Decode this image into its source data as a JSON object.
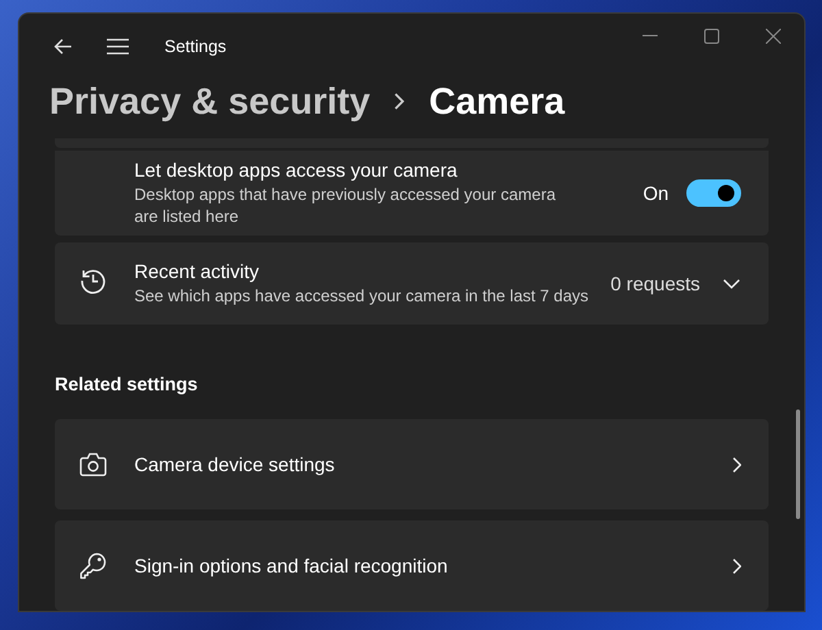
{
  "window": {
    "title": "Settings"
  },
  "breadcrumb": {
    "parent": "Privacy & security",
    "current": "Camera"
  },
  "desktop_apps": {
    "title": "Let desktop apps access your camera",
    "description": "Desktop apps that have previously accessed your camera are listed here",
    "state_label": "On",
    "on": true
  },
  "recent_activity": {
    "title": "Recent activity",
    "description": "See which apps have accessed your camera in the last 7 days",
    "value": "0 requests",
    "expanded": false
  },
  "related_settings": {
    "heading": "Related settings",
    "items": [
      {
        "label": "Camera device settings",
        "kind": "camera"
      },
      {
        "label": "Sign-in options and facial recognition",
        "kind": "key"
      }
    ]
  }
}
